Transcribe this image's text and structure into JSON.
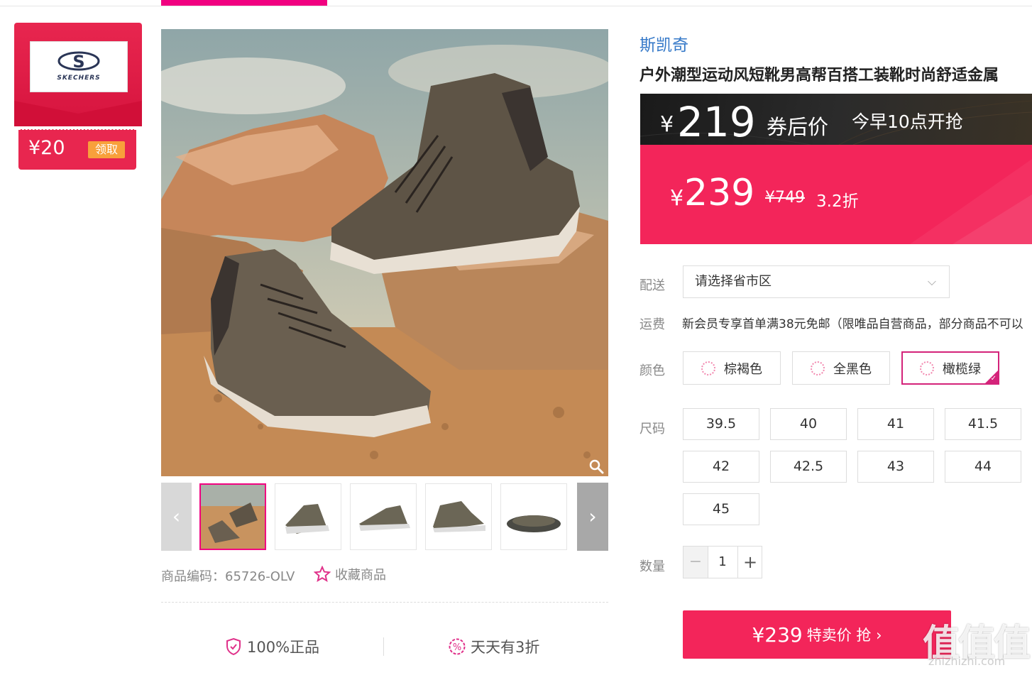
{
  "brand_card": {
    "logo_text": "SKECHERS",
    "coupon_value": "¥20",
    "coupon_button": "领取"
  },
  "gallery": {
    "thumb_count": 5,
    "prev_icon": "chevron-left-icon",
    "next_icon": "chevron-right-icon",
    "zoom_icon": "magnifier-icon"
  },
  "product_meta": {
    "sku_label": "商品编码：65726-OLV",
    "favorite_label": "收藏商品"
  },
  "guarantees": [
    {
      "label": "100%正品",
      "icon": "shield-check-icon"
    },
    {
      "label": "天天有3折",
      "icon": "percent-badge-icon"
    }
  ],
  "product": {
    "brand": "斯凯奇",
    "title": "户外潮型运动风短靴男高帮百搭工装靴时尚舒适金属"
  },
  "price_banner": {
    "coupon_price_symbol": "¥",
    "coupon_price": "219",
    "coupon_price_label": "券后价",
    "start_time": "今早10点开抢"
  },
  "price_main": {
    "symbol": "¥",
    "price": "239",
    "original_price": "¥749",
    "discount": "3.2折"
  },
  "delivery": {
    "label": "配送",
    "placeholder": "请选择省市区"
  },
  "shipping": {
    "label": "运费",
    "text": "新会员专享首单满38元免邮（限唯品自营商品，部分商品不可以"
  },
  "color": {
    "label": "颜色",
    "options": [
      "棕褐色",
      "全黑色",
      "橄榄绿"
    ],
    "selected": "橄榄绿"
  },
  "size": {
    "label": "尺码",
    "options": [
      "39.5",
      "40",
      "41",
      "41.5",
      "42",
      "42.5",
      "43",
      "44",
      "45"
    ]
  },
  "quantity": {
    "label": "数量",
    "minus": "−",
    "value": "1",
    "plus": "+"
  },
  "buy_button": {
    "price": "¥239",
    "text": "特卖价 抢 ›"
  },
  "watermark": {
    "text": "值值值",
    "sub": "zhizhizhi.com"
  },
  "colors": {
    "accent": "#f3255a",
    "brand_pink": "#f10180",
    "link_blue": "#3478c8"
  }
}
